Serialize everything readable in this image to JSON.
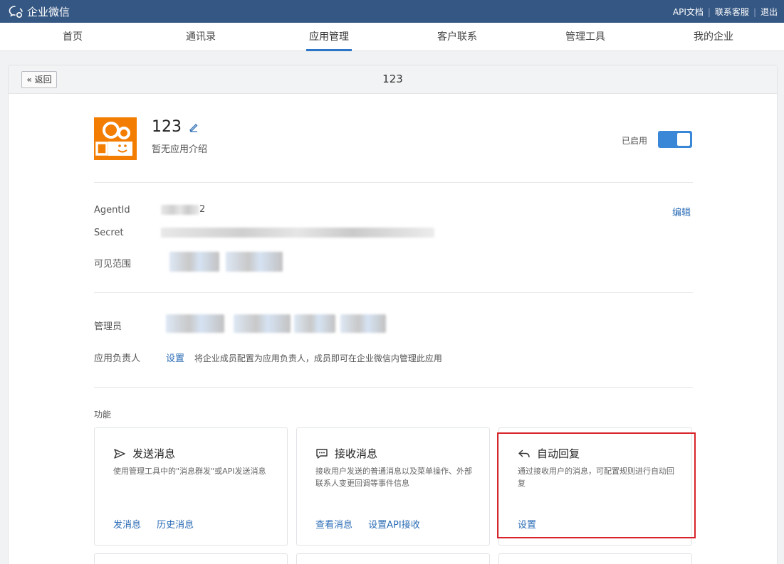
{
  "topbar": {
    "logo_text": "企业微信",
    "links": [
      "API文档",
      "联系客服",
      "退出"
    ]
  },
  "nav": {
    "items": [
      "首页",
      "通讯录",
      "应用管理",
      "客户联系",
      "管理工具",
      "我的企业"
    ],
    "active": "应用管理"
  },
  "header": {
    "back_label": "返回",
    "title": "123"
  },
  "app": {
    "name": "123",
    "description": "暂无应用介绍",
    "status_label": "已启用",
    "enabled": true
  },
  "details": {
    "agentid_label": "AgentId",
    "agentid_suffix": "2",
    "secret_label": "Secret",
    "visibility_label": "可见范围",
    "edit_label": "编辑"
  },
  "admin": {
    "admin_label": "管理员",
    "owner_label": "应用负责人",
    "owner_setting_link": "设置",
    "owner_hint": "将企业成员配置为应用负责人，成员即可在企业微信内管理此应用"
  },
  "features": {
    "section_label": "功能",
    "cards": [
      {
        "title": "发送消息",
        "icon": "send-icon",
        "desc": "使用管理工具中的\"消息群发\"或API发送消息",
        "links": [
          "发消息",
          "历史消息"
        ]
      },
      {
        "title": "接收消息",
        "icon": "chat-icon",
        "desc": "接收用户发送的普通消息以及菜单操作、外部联系人变更回调等事件信息",
        "links": [
          "查看消息",
          "设置API接收"
        ]
      },
      {
        "title": "自动回复",
        "icon": "reply-icon",
        "desc": "通过接收用户的消息，可配置规则进行自动回复",
        "links": [
          "设置"
        ]
      }
    ]
  },
  "colors": {
    "topbar": "#355783",
    "accent": "#2b6cb5",
    "app_icon": "#f37d00",
    "highlight": "#d8232a"
  }
}
